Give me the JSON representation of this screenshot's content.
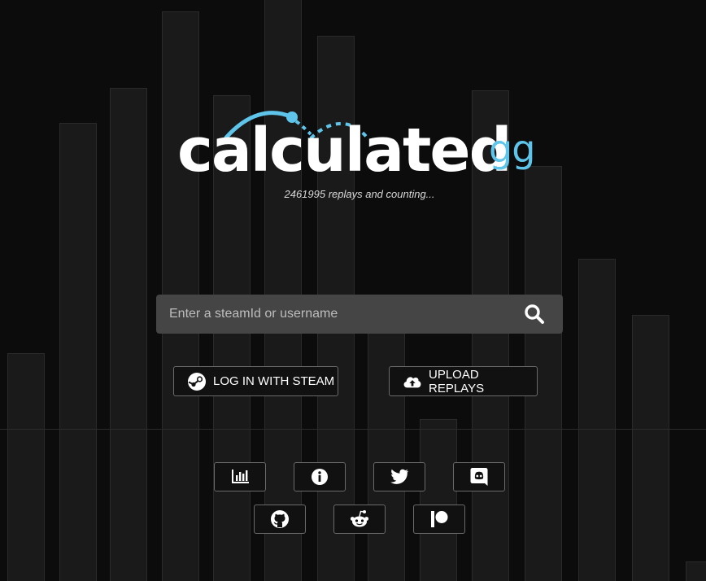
{
  "brand": {
    "word": "calculated",
    "suffix": "gg",
    "tagline": "2461995 replays and counting...",
    "accent_color": "#5fc4ea"
  },
  "search": {
    "placeholder": "Enter a steamId or username",
    "value": "",
    "icon": "search-icon"
  },
  "actions": {
    "login_label": "LOG IN WITH STEAM",
    "login_icon": "steam-icon",
    "upload_label": "UPLOAD REPLAYS",
    "upload_icon": "cloud-upload-icon"
  },
  "links": [
    {
      "icon": "stats-chart-icon"
    },
    {
      "icon": "info-icon"
    },
    {
      "icon": "twitter-icon"
    },
    {
      "icon": "discord-icon"
    },
    {
      "icon": "github-icon"
    },
    {
      "icon": "reddit-icon"
    },
    {
      "icon": "patreon-icon"
    }
  ]
}
